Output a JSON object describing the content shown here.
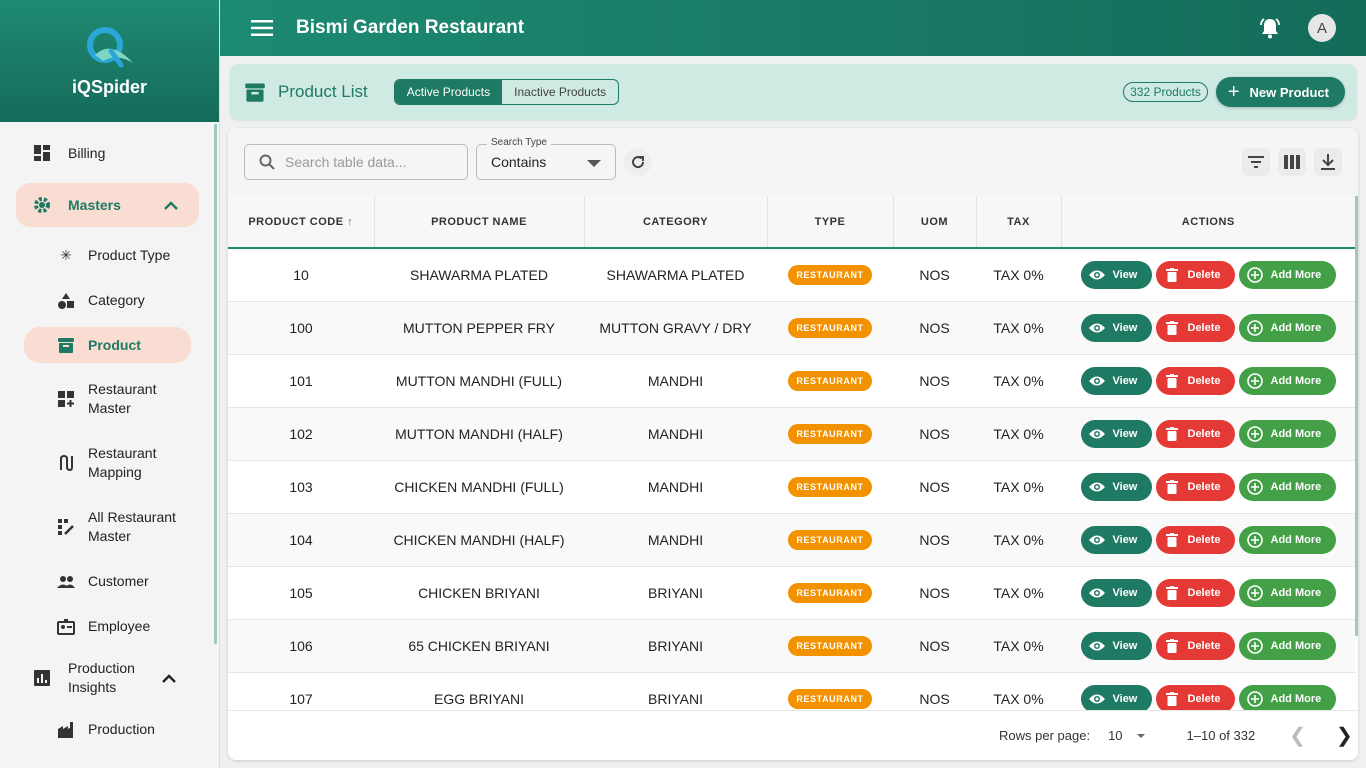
{
  "app": {
    "name": "iQSpider",
    "restaurant": "Bismi Garden Restaurant",
    "avatar_letter": "A"
  },
  "sidebar": {
    "billing": "Billing",
    "masters": "Masters",
    "sub": [
      "Product Type",
      "Category",
      "Product",
      "Restaurant Master",
      "Restaurant Mapping",
      "All Restaurant Master",
      "Customer",
      "Employee"
    ],
    "production_insights": "Production Insights",
    "production": "Production"
  },
  "banner": {
    "title": "Product List",
    "tab_active": "Active Products",
    "tab_inactive": "Inactive Products",
    "count": "332 Products",
    "new_button": "New Product"
  },
  "toolbar": {
    "search_placeholder": "Search table data...",
    "search_type_label": "Search Type",
    "search_type_value": "Contains"
  },
  "table": {
    "columns": [
      "PRODUCT CODE",
      "PRODUCT NAME",
      "CATEGORY",
      "TYPE",
      "UOM",
      "TAX",
      "ACTIONS"
    ],
    "sort_arrow": "↑",
    "rows": [
      {
        "code": "10",
        "name": "SHAWARMA PLATED",
        "category": "SHAWARMA PLATED",
        "type": "RESTAURANT",
        "uom": "NOS",
        "tax": "TAX 0%"
      },
      {
        "code": "100",
        "name": "MUTTON PEPPER FRY",
        "category": "MUTTON GRAVY / DRY",
        "type": "RESTAURANT",
        "uom": "NOS",
        "tax": "TAX 0%"
      },
      {
        "code": "101",
        "name": "MUTTON MANDHI (FULL)",
        "category": "MANDHI",
        "type": "RESTAURANT",
        "uom": "NOS",
        "tax": "TAX 0%"
      },
      {
        "code": "102",
        "name": "MUTTON MANDHI (HALF)",
        "category": "MANDHI",
        "type": "RESTAURANT",
        "uom": "NOS",
        "tax": "TAX 0%"
      },
      {
        "code": "103",
        "name": "CHICKEN MANDHI (FULL)",
        "category": "MANDHI",
        "type": "RESTAURANT",
        "uom": "NOS",
        "tax": "TAX 0%"
      },
      {
        "code": "104",
        "name": "CHICKEN MANDHI (HALF)",
        "category": "MANDHI",
        "type": "RESTAURANT",
        "uom": "NOS",
        "tax": "TAX 0%"
      },
      {
        "code": "105",
        "name": "CHICKEN BRIYANI",
        "category": "BRIYANI",
        "type": "RESTAURANT",
        "uom": "NOS",
        "tax": "TAX 0%"
      },
      {
        "code": "106",
        "name": "65 CHICKEN BRIYANI",
        "category": "BRIYANI",
        "type": "RESTAURANT",
        "uom": "NOS",
        "tax": "TAX 0%"
      },
      {
        "code": "107",
        "name": "EGG BRIYANI",
        "category": "BRIYANI",
        "type": "RESTAURANT",
        "uom": "NOS",
        "tax": "TAX 0%"
      }
    ],
    "actions": {
      "view": "View",
      "delete": "Delete",
      "add_more": "Add More"
    }
  },
  "pagination": {
    "rows_per_page_label": "Rows per page:",
    "rows_per_page": "10",
    "range": "1–10 of 332"
  },
  "colors": {
    "primary": "#1e7a63",
    "accent_bg": "#f9ddd3",
    "badge": "#f39200",
    "delete": "#e53935",
    "add": "#43a047"
  }
}
